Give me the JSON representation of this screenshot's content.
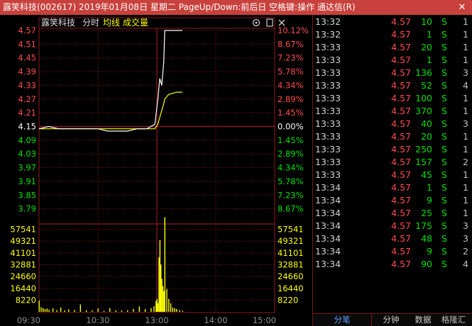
{
  "window": {
    "title": "露笑科技(002617)  2019年01月08日  星期二  PageUp/Down:前后日  空格键:操作  通达信(R)",
    "close_glyph": "✕"
  },
  "chart_header": {
    "stock_name": "露笑科技",
    "mode_label": "分时",
    "avg_label": "均线",
    "vol_label": "成交量",
    "icons": [
      "settings-icon",
      "restore-icon",
      "close-icon"
    ],
    "colors": {
      "price_line": "#ffffff",
      "avg_line": "#ffff00",
      "avg_label": "#ffff00",
      "vol_label": "#ffff00",
      "up": "#ff4d4d",
      "down": "#00e000",
      "flat": "#ffffff",
      "grid": "#8b1a1a"
    }
  },
  "price_axis": {
    "prices": [
      "4.57",
      "4.51",
      "4.45",
      "4.39",
      "4.33",
      "4.27",
      "4.21",
      "4.15",
      "4.09",
      "4.03",
      "3.97",
      "3.91",
      "3.85",
      "3.79"
    ],
    "percents": [
      "10.12%",
      "8.67%",
      "7.23%",
      "5.78%",
      "4.34%",
      "2.89%",
      "1.45%",
      "0.00%",
      "1.45%",
      "2.89%",
      "4.34%",
      "5.78%",
      "7.23%",
      "8.67%"
    ]
  },
  "volume_axis": {
    "labels": [
      "57541",
      "49321",
      "41101",
      "32881",
      "24660",
      "16440",
      "8220"
    ]
  },
  "time_axis": {
    "labels": [
      "09:30",
      "10:30",
      "13:00",
      "14:00",
      "15:00"
    ]
  },
  "chart_data": {
    "type": "line",
    "prev_close": 4.15,
    "price_range": [
      3.73,
      4.57
    ],
    "volume_max": 65761,
    "session_minutes": 240,
    "series": [
      {
        "minute": [
          0,
          10,
          20,
          30,
          40,
          50,
          60,
          70,
          80,
          90,
          100,
          110,
          118,
          121,
          123,
          125,
          127,
          128,
          130,
          132,
          140,
          146
        ],
        "price": [
          4.14,
          4.15,
          4.14,
          4.14,
          4.14,
          4.14,
          4.14,
          4.13,
          4.13,
          4.13,
          4.14,
          4.14,
          4.16,
          4.27,
          4.36,
          4.33,
          4.43,
          4.57,
          4.57,
          4.57,
          4.57,
          4.57
        ],
        "avg": [
          4.14,
          4.14,
          4.14,
          4.14,
          4.14,
          4.14,
          4.14,
          4.14,
          4.14,
          4.14,
          4.14,
          4.14,
          4.14,
          4.16,
          4.19,
          4.22,
          4.25,
          4.27,
          4.28,
          4.29,
          4.3,
          4.3
        ]
      }
    ],
    "volume": {
      "minute": [
        0,
        2,
        4,
        6,
        8,
        10,
        14,
        18,
        22,
        26,
        30,
        36,
        42,
        48,
        54,
        60,
        66,
        72,
        78,
        84,
        90,
        96,
        102,
        108,
        114,
        117,
        119,
        120,
        121,
        122,
        123,
        124,
        125,
        126,
        127,
        128,
        130,
        132,
        134,
        136,
        138,
        140,
        143,
        146
      ],
      "value": [
        7800,
        3200,
        2600,
        1800,
        2300,
        1500,
        2400,
        1200,
        3000,
        1100,
        1700,
        1300,
        5200,
        1200,
        900,
        2400,
        700,
        2600,
        1000,
        900,
        1100,
        2000,
        3800,
        1900,
        2600,
        4000,
        7500,
        9000,
        6000,
        38000,
        50000,
        33000,
        23000,
        18000,
        14500,
        66000,
        16000,
        9000,
        6000,
        3000,
        2500,
        2000,
        1200,
        800
      ]
    }
  },
  "ticks": [
    {
      "time": "13:32",
      "price": "4.57",
      "volume": "10",
      "side": "S",
      "count": "1"
    },
    {
      "time": "13:32",
      "price": "4.57",
      "volume": "1",
      "side": "S",
      "count": "1"
    },
    {
      "time": "13:33",
      "price": "4.57",
      "volume": "20",
      "side": "S",
      "count": "1"
    },
    {
      "time": "13:33",
      "price": "4.57",
      "volume": "1",
      "side": "S",
      "count": "1"
    },
    {
      "time": "13:33",
      "price": "4.57",
      "volume": "136",
      "side": "S",
      "count": "3"
    },
    {
      "time": "13:33",
      "price": "4.57",
      "volume": "52",
      "side": "S",
      "count": "4"
    },
    {
      "time": "13:33",
      "price": "4.57",
      "volume": "100",
      "side": "S",
      "count": "1"
    },
    {
      "time": "13:33",
      "price": "4.57",
      "volume": "370",
      "side": "S",
      "count": "1"
    },
    {
      "time": "13:33",
      "price": "4.57",
      "volume": "40",
      "side": "S",
      "count": "3"
    },
    {
      "time": "13:33",
      "price": "4.57",
      "volume": "20",
      "side": "S",
      "count": "1"
    },
    {
      "time": "13:33",
      "price": "4.57",
      "volume": "250",
      "side": "S",
      "count": "1"
    },
    {
      "time": "13:33",
      "price": "4.57",
      "volume": "157",
      "side": "S",
      "count": "2"
    },
    {
      "time": "13:33",
      "price": "4.57",
      "volume": "45",
      "side": "S",
      "count": "1"
    },
    {
      "time": "13:34",
      "price": "4.57",
      "volume": "1",
      "side": "S",
      "count": "1"
    },
    {
      "time": "13:34",
      "price": "4.57",
      "volume": "9",
      "side": "S",
      "count": "1"
    },
    {
      "time": "13:34",
      "price": "4.57",
      "volume": "25",
      "side": "S",
      "count": "1"
    },
    {
      "time": "13:34",
      "price": "4.57",
      "volume": "175",
      "side": "S",
      "count": "3"
    },
    {
      "time": "13:34",
      "price": "4.57",
      "volume": "48",
      "side": "S",
      "count": "3"
    },
    {
      "time": "13:34",
      "price": "4.57",
      "volume": "9",
      "side": "S",
      "count": "2"
    },
    {
      "time": "13:34",
      "price": "4.57",
      "volume": "90",
      "side": "S",
      "count": "4"
    }
  ],
  "bottom_tabs": {
    "tab1": "分笔",
    "tab2": "分钟",
    "tab3": "数据",
    "watermark": "格隆汇"
  }
}
